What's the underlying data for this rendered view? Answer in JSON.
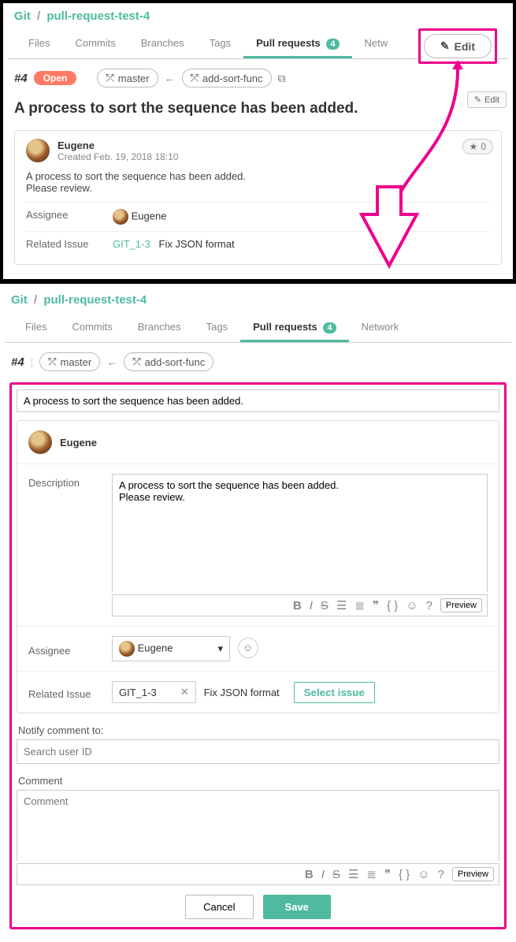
{
  "breadcrumb": {
    "root": "Git",
    "sep": "/",
    "repo": "pull-request-test-4"
  },
  "tabs": {
    "files": "Files",
    "commits": "Commits",
    "branches": "Branches",
    "tags": "Tags",
    "pulls": "Pull requests",
    "pulls_badge": "4",
    "network": "Network",
    "network_short": "Netw"
  },
  "pr": {
    "id": "#4",
    "state": "Open",
    "base": "master",
    "compare": "add-sort-func",
    "title": "A process to sort the sequence has been added."
  },
  "author": {
    "name": "Eugene",
    "created_prefix": "Created",
    "created_at": "Feb. 19, 2018 18:10",
    "stars": "0"
  },
  "body_line1": "A process to sort the sequence has been added.",
  "body_line2": "Please review.",
  "kv_assignee": {
    "label": "Assignee",
    "value": "Eugene"
  },
  "kv_issue": {
    "label": "Related Issue",
    "key": "GIT_1-3",
    "summary": "Fix JSON format"
  },
  "edit": {
    "big": "Edit",
    "small": "Edit"
  },
  "form": {
    "title_value": "A process to sort the sequence has been added.",
    "desc_label": "Description",
    "desc_value": "A process to sort the sequence has been added.\nPlease review.",
    "assignee_label": "Assignee",
    "assignee_value": "Eugene",
    "issue_label": "Related Issue",
    "issue_key": "GIT_1-3",
    "issue_summary": "Fix JSON format",
    "select_issue_btn": "Select issue",
    "notify_label": "Notify comment to:",
    "notify_placeholder": "Search user ID",
    "comment_label": "Comment",
    "comment_placeholder": "Comment",
    "preview": "Preview",
    "cancel": "Cancel",
    "save": "Save"
  },
  "colors": {
    "brand": "#4FBA9F",
    "accent": "#EC008C",
    "open": "#FF7A63"
  }
}
